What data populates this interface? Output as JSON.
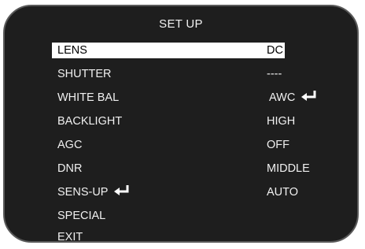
{
  "osd": {
    "title": "SET UP",
    "enter_icon": "enter-arrow-icon",
    "selected_index": 0,
    "items": [
      {
        "label": "LENS",
        "value": "DC"
      },
      {
        "label": "SHUTTER",
        "value": "----"
      },
      {
        "label": "WHITE BAL",
        "value": "AWC"
      },
      {
        "label": "BACKLIGHT",
        "value": "HIGH"
      },
      {
        "label": "AGC",
        "value": "OFF"
      },
      {
        "label": "DNR",
        "value": "MIDDLE"
      },
      {
        "label": "SENS-UP",
        "value": "AUTO"
      },
      {
        "label": "SPECIAL",
        "value": ""
      },
      {
        "label": "EXIT",
        "value": ""
      }
    ]
  }
}
